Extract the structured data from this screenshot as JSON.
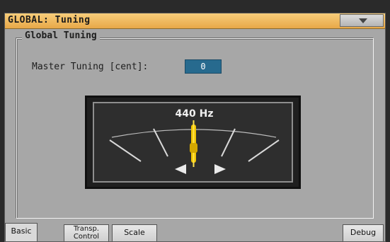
{
  "header": {
    "title": "GLOBAL: Tuning",
    "menu_icon": "chevron-down-icon"
  },
  "panel": {
    "legend": "Global Tuning",
    "master_tuning_label": "Master Tuning [cent]:",
    "master_tuning_value": "0"
  },
  "meter": {
    "frequency_text": "440 Hz",
    "left_arrow_icon": "arrow-left-icon",
    "right_arrow_icon": "arrow-right-icon",
    "needle_color": "#f0c400"
  },
  "tabs": {
    "basic": "Basic",
    "transp_line1": "Transp.",
    "transp_line2": "Control",
    "scale": "Scale",
    "debug": "Debug"
  }
}
